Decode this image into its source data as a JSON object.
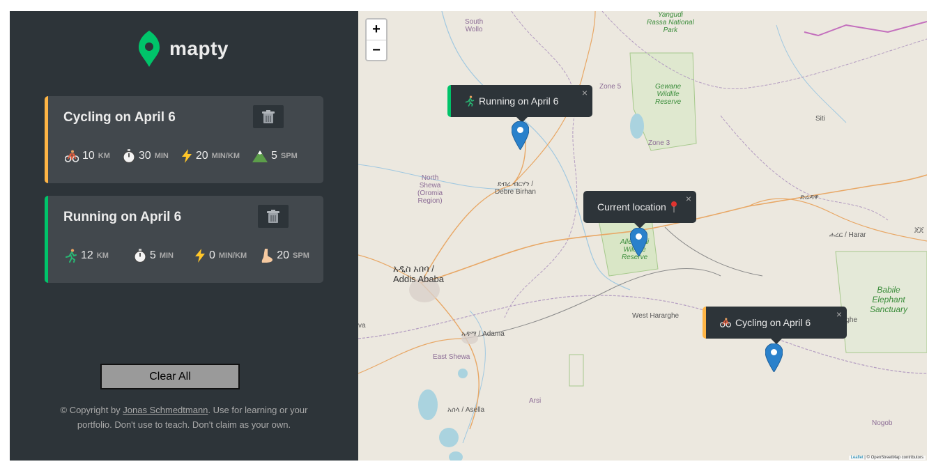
{
  "app": {
    "name": "mapty"
  },
  "workouts": [
    {
      "type": "cycling",
      "title": "Cycling on April 6",
      "stats": [
        {
          "icon": "bicycle-icon",
          "value": "10",
          "unit": "km"
        },
        {
          "icon": "stopwatch-icon",
          "value": "30",
          "unit": "min"
        },
        {
          "icon": "lightning-icon",
          "value": "20",
          "unit": "min/km"
        },
        {
          "icon": "mountain-icon",
          "value": "5",
          "unit": "spm"
        }
      ]
    },
    {
      "type": "running",
      "title": "Running on April 6",
      "stats": [
        {
          "icon": "runner-icon",
          "value": "12",
          "unit": "km"
        },
        {
          "icon": "stopwatch-icon",
          "value": "5",
          "unit": "min"
        },
        {
          "icon": "lightning-icon",
          "value": "0",
          "unit": "min/km"
        },
        {
          "icon": "foot-icon",
          "value": "20",
          "unit": "spm"
        }
      ]
    }
  ],
  "controls": {
    "clear_all": "Clear All"
  },
  "footer": {
    "prefix": "© Copyright by ",
    "author": "Jonas Schmedtmann",
    "suffix": ". Use for learning or your portfolio. Don't use to teach. Don't claim as your own."
  },
  "map": {
    "zoom_in": "+",
    "zoom_out": "−",
    "close_symbol": "×",
    "popups": {
      "running": "Running on April 6",
      "current": "Current location",
      "cycling": "Cycling on April 6"
    },
    "labels": {
      "south_wollo": "South\nWollo",
      "yangudi": "Yangudi\nRassa National\nPark",
      "zone5": "Zone 5",
      "gewane": "Gewane\nWildlife\nReserve",
      "zone3": "Zone 3",
      "siti": "Siti",
      "north_shewa": "North\nShewa\n(Oromia\nRegion)",
      "debre_birhan": "ደብረ ብርሃን /\nDebre Birhan",
      "dire_dawa": "ድሬዳዋ",
      "harar": "ሐረር / Harar",
      "harar_edge": "ጀጀ",
      "addis": "አዲስ አበባ /\nAddis Ababa",
      "allideghi": "Alledeghi\nWildlife\nReserve",
      "west_hararghe": "West Hararghe",
      "hararghe_edge": "rghe",
      "babile": "Babile\nElephant\nSanctuary",
      "adama": "አዳማ / Adama",
      "east_shewa": "East Shewa",
      "wa_edge": "va",
      "arsi": "Arsi",
      "asella": "አሰላ / Asella",
      "nogob": "Nogob"
    },
    "attribution_leaflet": "Leaflet",
    "attribution_rest": " | © OpenStreetMap contributors"
  }
}
